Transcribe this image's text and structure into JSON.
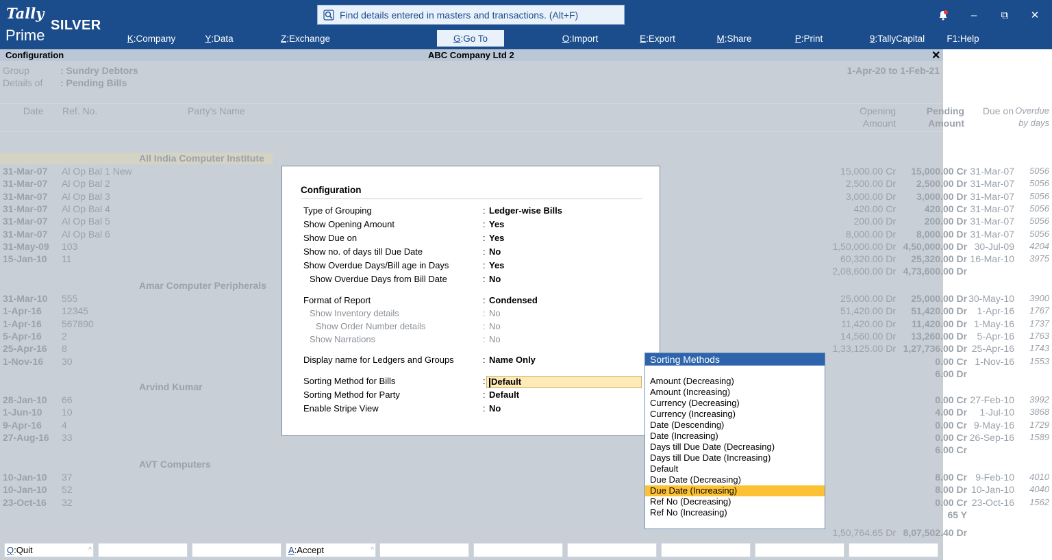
{
  "app": {
    "logo_top": "Tally",
    "logo_bottom": "Prime",
    "edition": "SILVER"
  },
  "search": {
    "text": "Find details entered in masters and transactions. (Alt+F)"
  },
  "menu": [
    {
      "key": "K",
      "label": "Company"
    },
    {
      "key": "Y",
      "label": "Data"
    },
    {
      "key": "Z",
      "label": "Exchange"
    },
    {
      "key": "G",
      "label": "Go To"
    },
    {
      "key": "O",
      "label": "Import"
    },
    {
      "key": "E",
      "label": "Export"
    },
    {
      "key": "M",
      "label": "Share"
    },
    {
      "key": "P",
      "label": "Print"
    },
    {
      "key": "9",
      "label": "TallyCapital"
    },
    {
      "key": "F1",
      "label": "Help"
    }
  ],
  "window": {
    "minimize": "–",
    "restore": "⧉",
    "close": "✕",
    "notify": "🔔"
  },
  "titlebar": {
    "left": "Configuration",
    "center": "ABC Company Ltd 2",
    "close": "✕"
  },
  "report": {
    "group_label": "Group",
    "group_value": ": Sundry Debtors",
    "details_label": "Details of",
    "details_value": ": Pending Bills",
    "period": "1-Apr-20 to 1-Feb-21",
    "columns": {
      "date": "Date",
      "ref": "Ref. No.",
      "party": "Party's Name",
      "opening1": "Opening",
      "opening2": "Amount",
      "pending1": "Pending",
      "pending2": "Amount",
      "due": "Due on",
      "overdue1": "Overdue",
      "overdue2": "by days"
    },
    "groups": [
      {
        "name": "All India Computer Institute",
        "rows": [
          [
            "31-Mar-07",
            "Al Op Bal 1 New",
            "15,000.00 Cr",
            "15,000.00 Cr",
            "31-Mar-07",
            "5056"
          ],
          [
            "31-Mar-07",
            "Al Op Bal 2",
            "2,500.00 Dr",
            "2,500.00 Dr",
            "31-Mar-07",
            "5056"
          ],
          [
            "31-Mar-07",
            "Al Op Bal 3",
            "3,000.00 Dr",
            "3,000.00 Dr",
            "31-Mar-07",
            "5056"
          ],
          [
            "31-Mar-07",
            "Al Op Bal 4",
            "420.00 Cr",
            "420.00 Cr",
            "31-Mar-07",
            "5056"
          ],
          [
            "31-Mar-07",
            "Al Op Bal 5",
            "200.00 Dr",
            "200.00 Dr",
            "31-Mar-07",
            "5056"
          ],
          [
            "31-Mar-07",
            "Al Op Bal 6",
            "8,000.00 Dr",
            "8,000.00 Dr",
            "31-Mar-07",
            "5056"
          ],
          [
            "31-May-09",
            "103",
            "1,50,000.00 Dr",
            "4,50,000.00 Dr",
            "30-Jul-09",
            "4204"
          ],
          [
            "15-Jan-10",
            "11",
            "60,320.00 Dr",
            "25,320.00 Dr",
            "16-Mar-10",
            "3975"
          ]
        ],
        "total": [
          "2,08,600.00 Dr",
          "4,73,600.00 Dr"
        ]
      },
      {
        "name": "Amar Computer Peripherals",
        "rows": [
          [
            "31-Mar-10",
            "555",
            "25,000.00 Dr",
            "25,000.00 Dr",
            "30-May-10",
            "3900"
          ],
          [
            "1-Apr-16",
            "12345",
            "51,420.00 Dr",
            "51,420.00 Dr",
            "1-Apr-16",
            "1767"
          ],
          [
            "1-Apr-16",
            "567890",
            "11,420.00 Dr",
            "11,420.00 Dr",
            "1-May-16",
            "1737"
          ],
          [
            "5-Apr-16",
            "2",
            "14,560.00 Dr",
            "13,260.00 Dr",
            "5-Apr-16",
            "1763"
          ],
          [
            "25-Apr-16",
            "8",
            "1,33,125.00 Dr",
            "1,27,736.00 Dr",
            "25-Apr-16",
            "1743"
          ],
          [
            "1-Nov-16",
            "30",
            "",
            "0.00 Cr",
            "1-Nov-16",
            "1553"
          ]
        ],
        "total": [
          "",
          "6.00 Dr"
        ]
      },
      {
        "name": "Arvind Kumar",
        "rows": [
          [
            "28-Jan-10",
            "66",
            "",
            "0.00 Cr",
            "27-Feb-10",
            "3992"
          ],
          [
            "1-Jun-10",
            "10",
            "",
            "4.00 Dr",
            "1-Jul-10",
            "3868"
          ],
          [
            "9-Apr-16",
            "4",
            "",
            "0.00 Cr",
            "9-May-16",
            "1729"
          ],
          [
            "27-Aug-16",
            "33",
            "",
            "0.00 Cr",
            "26-Sep-16",
            "1589"
          ]
        ],
        "total": [
          "",
          "6.00 Cr"
        ]
      },
      {
        "name": "AVT Computers",
        "rows": [
          [
            "10-Jan-10",
            "37",
            "",
            "8.00 Cr",
            "9-Feb-10",
            "4010"
          ],
          [
            "10-Jan-10",
            "52",
            "",
            "8.00 Dr",
            "10-Jan-10",
            "4040"
          ],
          [
            "23-Oct-16",
            "32",
            "",
            "0.00 Cr",
            "23-Oct-16",
            "1562"
          ]
        ],
        "total": [
          "",
          "65 Y"
        ]
      }
    ],
    "grand_total": [
      "1,50,764.65 Dr",
      "8,07,502.40 Dr"
    ]
  },
  "config": {
    "title": "Configuration",
    "rows": [
      {
        "label": "Type of Grouping",
        "value": "Ledger-wise Bills"
      },
      {
        "label": "Show Opening Amount",
        "value": "Yes"
      },
      {
        "label": "Show Due on",
        "value": "Yes"
      },
      {
        "label": "Show no. of days till Due Date",
        "value": "No"
      },
      {
        "label": "Show Overdue Days/Bill age in Days",
        "value": "Yes"
      },
      {
        "label": "Show Overdue Days from Bill Date",
        "value": "No"
      },
      {
        "label": "Format of Report",
        "value": "Condensed"
      },
      {
        "label": "Show Inventory details",
        "value": "No"
      },
      {
        "label": "Show Order Number details",
        "value": "No"
      },
      {
        "label": "Show Narrations",
        "value": "No"
      },
      {
        "label": "Display name for Ledgers and Groups",
        "value": "Name Only"
      },
      {
        "label": "Sorting Method for Bills",
        "value": "Default"
      },
      {
        "label": "Sorting Method for Party",
        "value": "Default"
      },
      {
        "label": "Enable Stripe View",
        "value": "No"
      }
    ]
  },
  "sorting": {
    "title": "Sorting Methods",
    "selected": "Due Date (Increasing)",
    "options": [
      "Amount (Decreasing)",
      "Amount (Increasing)",
      "Currency (Decreasing)",
      "Currency (Increasing)",
      "Date (Descending)",
      "Date (Increasing)",
      "Days till Due Date (Decreasing)",
      "Days till Due Date (Increasing)",
      "Default",
      "Due Date (Decreasing)",
      "Due Date (Increasing)",
      "Ref No (Decreasing)",
      "Ref No (Increasing)"
    ]
  },
  "footer": [
    {
      "key": "Q",
      "label": "Quit"
    },
    {
      "key": "",
      "label": ""
    },
    {
      "key": "",
      "label": ""
    },
    {
      "key": "A",
      "label": "Accept"
    },
    {
      "key": "",
      "label": ""
    },
    {
      "key": "",
      "label": ""
    },
    {
      "key": "",
      "label": ""
    },
    {
      "key": "",
      "label": ""
    },
    {
      "key": "",
      "label": ""
    },
    {
      "key": "",
      "label": ""
    }
  ]
}
